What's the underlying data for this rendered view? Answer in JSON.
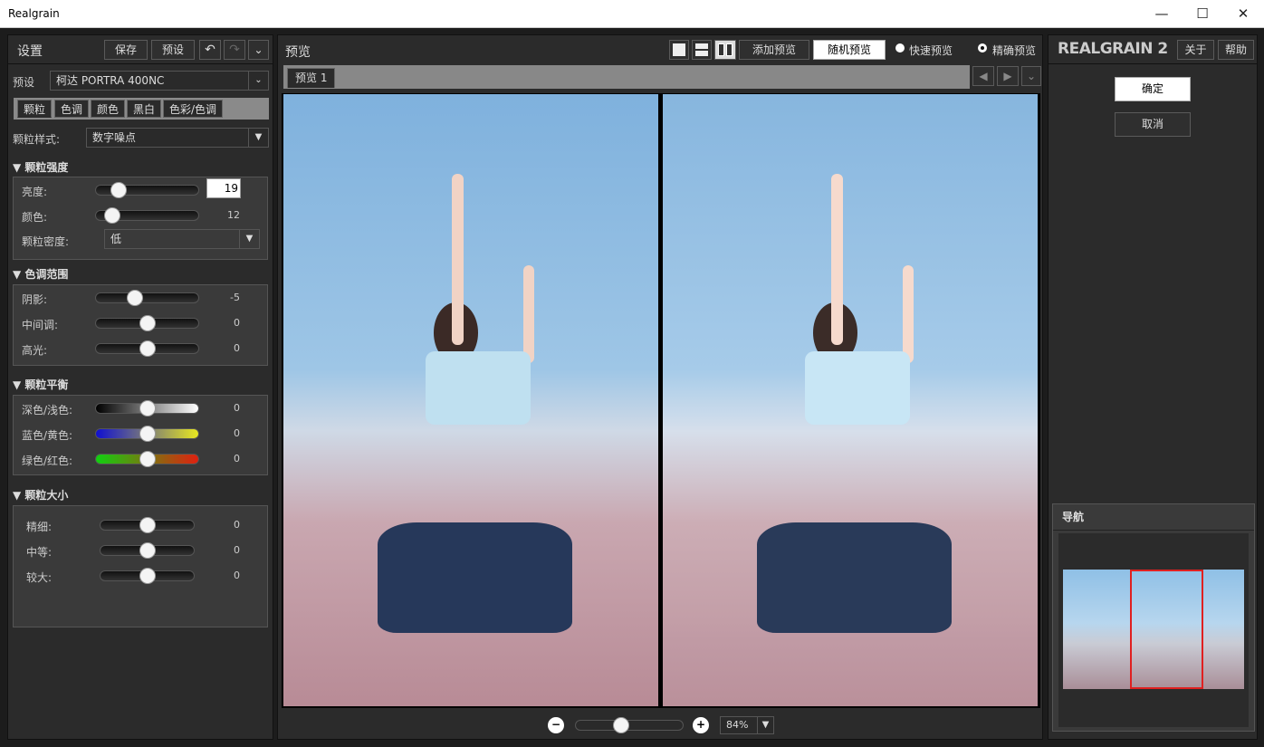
{
  "app": {
    "title": "Realgrain"
  },
  "settings": {
    "title": "设置",
    "save": "保存",
    "preset_btn": "预设",
    "preset_label": "预设",
    "preset_value": "柯达 PORTRA 400NC",
    "tabs": [
      "颗粒",
      "色调",
      "颜色",
      "黑白",
      "色彩/色调"
    ],
    "grain_style_label": "颗粒样式:",
    "grain_style_value": "数字噪点",
    "sections": {
      "strength": {
        "title": "颗粒强度",
        "brightness_label": "亮度:",
        "brightness_value": "19",
        "brightness_pos": 0.22,
        "color_label": "颜色:",
        "color_value": "12",
        "color_pos": 0.16,
        "density_label": "颗粒密度:",
        "density_value": "低"
      },
      "tone": {
        "title": "色调范围",
        "rows": [
          {
            "label": "阴影:",
            "value": "-5",
            "pos": 0.38
          },
          {
            "label": "中间调:",
            "value": "0",
            "pos": 0.5
          },
          {
            "label": "高光:",
            "value": "0",
            "pos": 0.5
          }
        ]
      },
      "balance": {
        "title": "颗粒平衡",
        "rows": [
          {
            "label": "深色/浅色:",
            "value": "0",
            "pos": 0.5,
            "grad": "linear-gradient(90deg,#000,#fff)"
          },
          {
            "label": "蓝色/黄色:",
            "value": "0",
            "pos": 0.5,
            "grad": "linear-gradient(90deg,#1010d0,#e8e820)"
          },
          {
            "label": "绿色/红色:",
            "value": "0",
            "pos": 0.5,
            "grad": "linear-gradient(90deg,#10d010,#e02010)"
          }
        ]
      },
      "size": {
        "title": "颗粒大小",
        "rows": [
          {
            "label": "精细:",
            "value": "0",
            "pos": 0.5
          },
          {
            "label": "中等:",
            "value": "0",
            "pos": 0.5
          },
          {
            "label": "较大:",
            "value": "0",
            "pos": 0.5
          }
        ]
      }
    }
  },
  "preview": {
    "title": "预览",
    "add": "添加预览",
    "random": "随机预览",
    "fast": "快速预览",
    "precise": "精确预览",
    "tab": "预览 1",
    "zoom": "84%",
    "zoom_pos": 0.42
  },
  "right": {
    "logo": "REALGRAIN 2",
    "about": "关于",
    "help": "帮助",
    "ok": "确定",
    "cancel": "取消",
    "nav": "导航"
  }
}
